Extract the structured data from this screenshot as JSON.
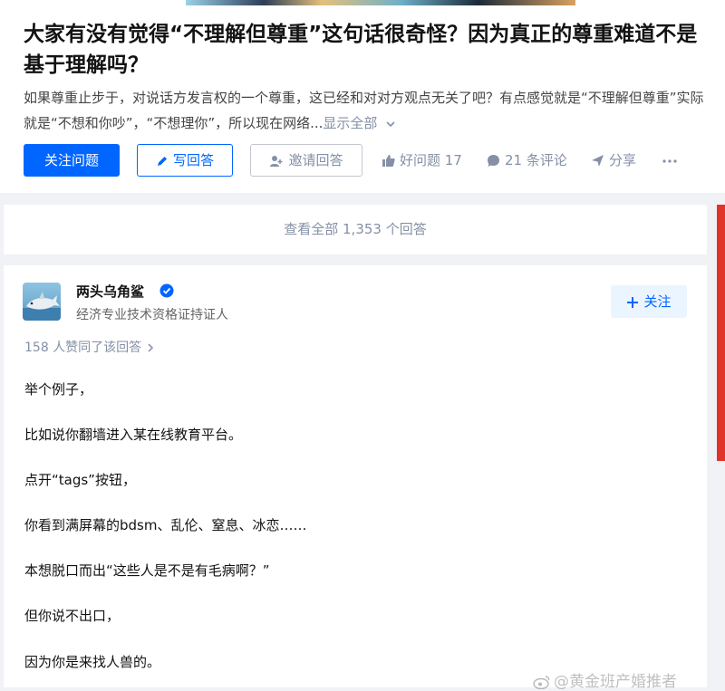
{
  "question": {
    "title": "大家有没有觉得“不理解但尊重”这句话很奇怪？因为真正的尊重难道不是基于理解吗？",
    "description": "如果尊重止步于，对说话方发言权的一个尊重，这已经和对对方观点无关了吧？有点感觉就是“不理解但尊重”实际就是“不想和你吵”，“不想理你”，所以现在网络...",
    "show_all_label": "显示全部",
    "follow_button": "关注问题",
    "write_answer_button": "写回答",
    "invite_button": "邀请回答",
    "good_question": "好问题 17",
    "comments": "21 条评论",
    "share": "分享"
  },
  "view_all_answers": "查看全部 1,353 个回答",
  "answer": {
    "author_name": "两头乌角鲨",
    "author_bio": "经济专业技术资格证持证人",
    "follow_button": "关注",
    "votes": "158 人赞同了该回答",
    "paragraphs": [
      "举个例子，",
      "比如说你翻墙进入某在线教育平台。",
      "点开“tags”按钮，",
      "你看到满屏幕的bdsm、乱伦、窒息、冰恋……",
      "本想脱口而出“这些人是不是有毛病啊？”",
      "但你说不出口，",
      "因为你是来找人兽的。"
    ]
  },
  "watermark": "@黄金班产婚推者",
  "colors": {
    "accent": "#0066ff",
    "meta": "#8590a6",
    "edge": "#e0342b"
  },
  "icons": [
    "pencil-icon",
    "invite-user-icon",
    "thumbs-up-icon",
    "comment-icon",
    "share-icon",
    "more-icon",
    "verified-icon",
    "plus-icon",
    "chevron-down-icon",
    "chevron-right-icon",
    "weibo-icon"
  ]
}
